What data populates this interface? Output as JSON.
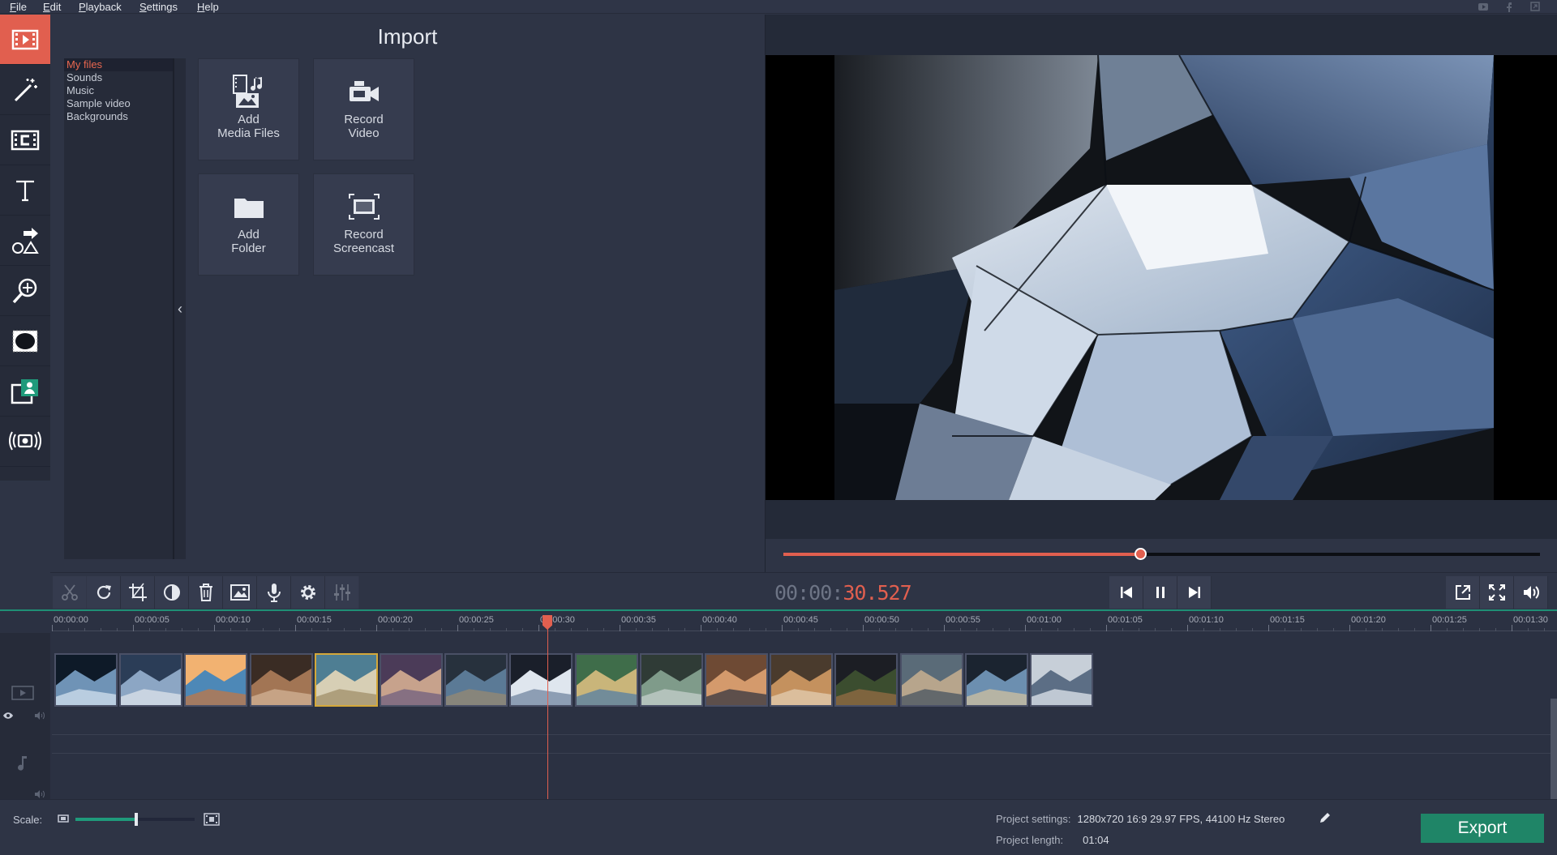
{
  "menu": {
    "items": [
      "File",
      "Edit",
      "Playback",
      "Settings",
      "Help"
    ],
    "top_icons": [
      "youtube-icon",
      "facebook-icon",
      "share-icon"
    ]
  },
  "left_tools": [
    {
      "name": "import-tool",
      "icon": "film-import-icon",
      "active": true
    },
    {
      "name": "filters-tool",
      "icon": "magic-wand-icon",
      "active": false
    },
    {
      "name": "transitions-tool",
      "icon": "film-transition-icon",
      "active": false
    },
    {
      "name": "titles-tool",
      "icon": "text-t-icon",
      "active": false
    },
    {
      "name": "stickers-tool",
      "icon": "shapes-icon",
      "active": false
    },
    {
      "name": "zoom-pan-tool",
      "icon": "zoom-icon",
      "active": false
    },
    {
      "name": "more-tools",
      "icon": "vignette-icon",
      "active": false
    },
    {
      "name": "overlay-tool",
      "icon": "picture-in-picture-icon",
      "active": false
    },
    {
      "name": "capture-tool",
      "icon": "webcam-broadcast-icon",
      "active": false
    }
  ],
  "import": {
    "title": "Import",
    "categories": [
      "My files",
      "Sounds",
      "Music",
      "Sample video",
      "Backgrounds"
    ],
    "selected_category": "My files",
    "tiles": [
      {
        "label": "Add\nMedia Files",
        "icon": "media-files-icon"
      },
      {
        "label": "Record\nVideo",
        "icon": "video-camera-icon"
      },
      {
        "label": "Add\nFolder",
        "icon": "folder-icon"
      },
      {
        "label": "Record\nScreencast",
        "icon": "screencast-icon"
      }
    ]
  },
  "player": {
    "timecode_prefix": "00:00:",
    "timecode_value": "30.527",
    "progress": 0.472
  },
  "edit_tools": [
    "cut-icon",
    "rotate-icon",
    "crop-icon",
    "color-adjust-icon",
    "delete-icon",
    "image-icon",
    "microphone-icon",
    "settings-gear-icon",
    "equalizer-icon"
  ],
  "timeline": {
    "ruler_labels": [
      "00:00:00",
      "00:00:05",
      "00:00:10",
      "00:00:15",
      "00:00:20",
      "00:00:25",
      "00:00:30",
      "00:00:35",
      "00:00:40",
      "00:00:45",
      "00:00:50",
      "00:00:55",
      "00:01:00",
      "00:01:05",
      "00:01:10",
      "00:01:15",
      "00:01:20",
      "00:01:25",
      "00:01:30"
    ],
    "clip_count": 16,
    "selected_clip_index": 4
  },
  "status": {
    "scale_label": "Scale:",
    "scale_value": 0.51,
    "project_settings_label": "Project settings:",
    "project_settings_value": "1280x720 16:9 29.97 FPS, 44100 Hz Stereo",
    "project_length_label": "Project length:",
    "project_length_value": "01:04",
    "export_label": "Export"
  },
  "colors": {
    "accent": "#e15f4f",
    "export_green": "#1f8567",
    "timeline_green": "#1f8f75"
  }
}
